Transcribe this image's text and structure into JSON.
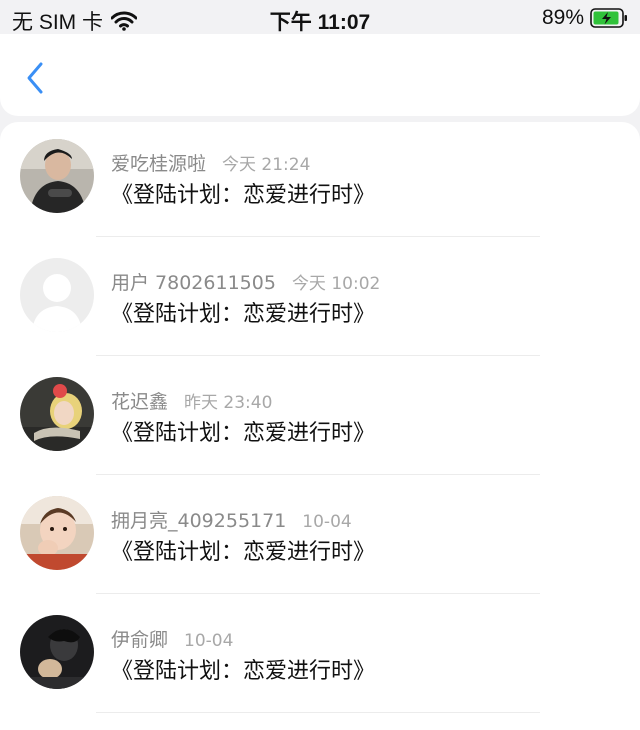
{
  "status_bar": {
    "carrier": "无 SIM 卡",
    "time": "下午 11:07",
    "battery": "89%"
  },
  "header": {
    "back_icon": "chevron-left-icon",
    "accent_color": "#3a8ff5"
  },
  "items": [
    {
      "username": "爱吃桂源啦",
      "time": "今天 21:24",
      "title": "《登陆计划：恋爱进行时》"
    },
    {
      "username": "用户 7802611505",
      "time": "今天 10:02",
      "title": "《登陆计划：恋爱进行时》"
    },
    {
      "username": "花迟鑫",
      "time": "昨天 23:40",
      "title": "《登陆计划：恋爱进行时》"
    },
    {
      "username": "拥月亮_409255171",
      "time": "10-04",
      "title": "《登陆计划：恋爱进行时》"
    },
    {
      "username": "伊俞卿",
      "time": "10-04",
      "title": "《登陆计划：恋爱进行时》"
    }
  ]
}
